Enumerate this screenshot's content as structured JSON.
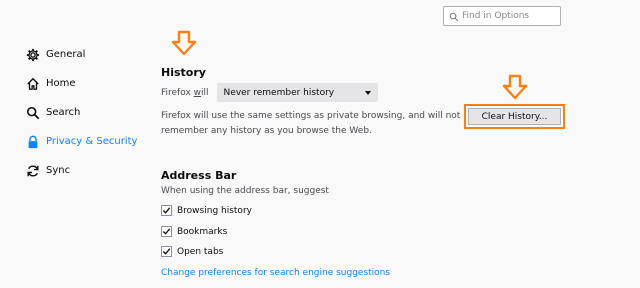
{
  "search": {
    "placeholder": "Find in Options"
  },
  "sidebar": {
    "items": [
      {
        "label": "General",
        "icon": "gear-icon"
      },
      {
        "label": "Home",
        "icon": "home-icon"
      },
      {
        "label": "Search",
        "icon": "search-icon"
      },
      {
        "label": "Privacy & Security",
        "icon": "lock-icon",
        "active": true
      },
      {
        "label": "Sync",
        "icon": "sync-icon"
      }
    ]
  },
  "history": {
    "title": "History",
    "label_prefix": "Firefox ",
    "label_underlined": "w",
    "label_suffix": "ill",
    "select_value": "Never remember history",
    "description_line1": "Firefox will use the same settings as private browsing, and will not",
    "description_line2": "remember any history as you browse the Web.",
    "clear_button": "Clear History..."
  },
  "address_bar": {
    "title": "Address Bar",
    "subtitle": "When using the address bar, suggest",
    "options": [
      {
        "label": "Browsing history",
        "checked": true
      },
      {
        "label": "Bookmarks",
        "checked": true
      },
      {
        "label": "Open tabs",
        "checked": true
      }
    ],
    "link": "Change preferences for search engine suggestions"
  },
  "colors": {
    "accent": "#0a84ff",
    "annotation": "#ff7e0f"
  }
}
